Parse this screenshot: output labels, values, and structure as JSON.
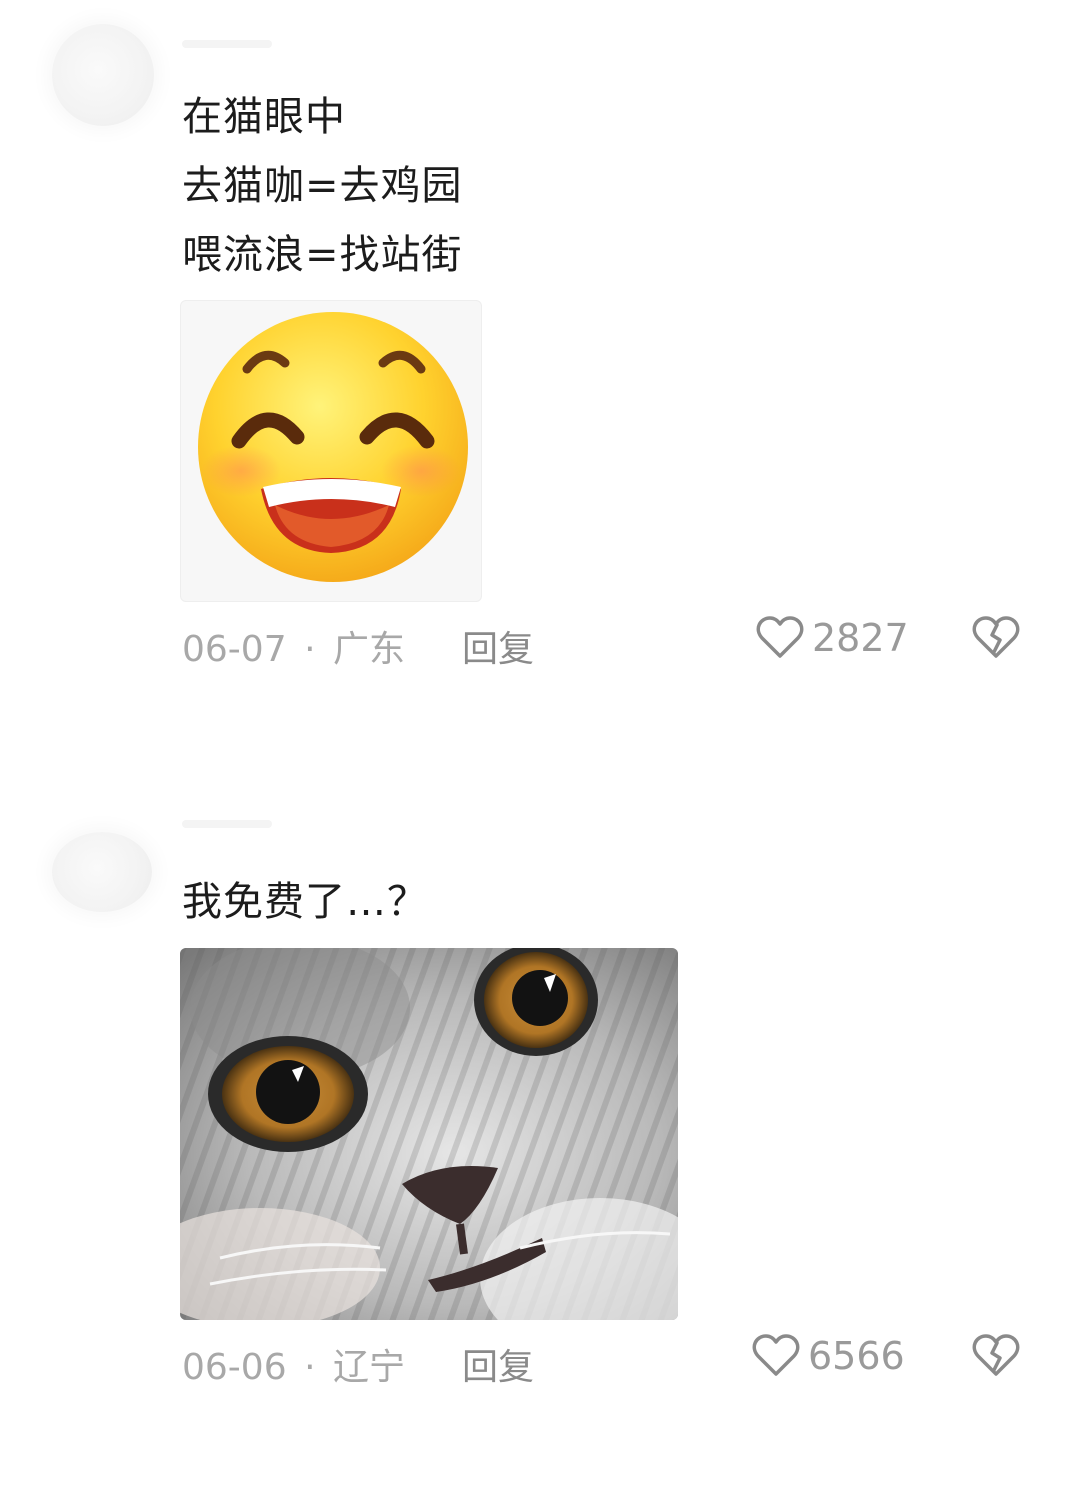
{
  "comments": [
    {
      "lines": [
        "在猫眼中",
        "去猫咖=去鸡园",
        "喂流浪=找站街"
      ],
      "date": "06-07",
      "separator": "·",
      "location": "广东",
      "reply_label": "回复",
      "likes": "2827",
      "media": {
        "type": "emoji",
        "icon": "grinning-face-emoji"
      }
    },
    {
      "lines": [
        "我免费了…？"
      ],
      "date": "06-06",
      "separator": "·",
      "location": "辽宁",
      "reply_label": "回复",
      "likes": "6566",
      "media": {
        "type": "photo",
        "icon": "cat-face-closeup"
      }
    }
  ],
  "colors": {
    "text": "#1c1c1c",
    "meta": "#a8a8a8",
    "icon": "#8a8a8a"
  }
}
